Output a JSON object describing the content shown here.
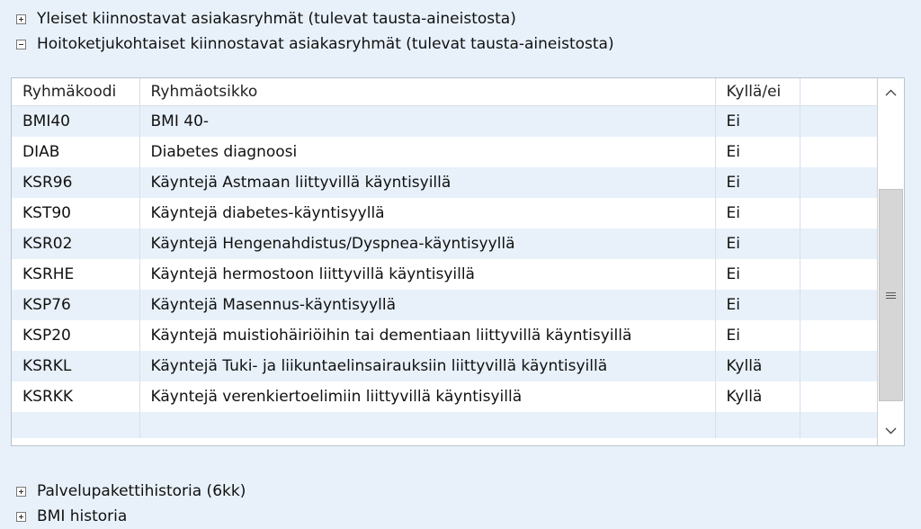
{
  "sections": {
    "general_groups": "Yleiset kiinnostavat asiakasryhmät (tulevat tausta-aineistosta)",
    "care_chain_groups": "Hoitoketjukohtaiset kiinnostavat asiakasryhmät (tulevat tausta-aineistosta)",
    "service_history": "Palvelupakettihistoria (6kk)",
    "bmi_history": "BMI historia"
  },
  "table": {
    "columns": [
      "Ryhmäkoodi",
      "Ryhmäotsikko",
      "Kyllä/ei"
    ],
    "rows": [
      {
        "code": "BMI40",
        "title": "BMI 40-",
        "value": "Ei"
      },
      {
        "code": "DIAB",
        "title": "Diabetes diagnoosi",
        "value": "Ei"
      },
      {
        "code": "KSR96",
        "title": "Käyntejä Astmaan liittyvillä käyntisyillä",
        "value": "Ei"
      },
      {
        "code": "KST90",
        "title": "Käyntejä diabetes-käyntisyyllä",
        "value": "Ei"
      },
      {
        "code": "KSR02",
        "title": "Käyntejä Hengenahdistus/Dyspnea-käyntisyyllä",
        "value": "Ei"
      },
      {
        "code": "KSRHE",
        "title": "Käyntejä hermostoon liittyvillä käyntisyillä",
        "value": "Ei"
      },
      {
        "code": "KSP76",
        "title": "Käyntejä Masennus-käyntisyyllä",
        "value": "Ei"
      },
      {
        "code": "KSP20",
        "title": "Käyntejä muistiohäiriöihin tai dementiaan liittyvillä käyntisyillä",
        "value": "Ei"
      },
      {
        "code": "KSRKL",
        "title": "Käyntejä Tuki- ja liikuntaelinsairauksiin liittyvillä käyntisyillä",
        "value": "Kyllä"
      },
      {
        "code": "KSRKK",
        "title": "Käyntejä verenkiertoelimiin liittyvillä käyntisyillä",
        "value": "Kyllä"
      }
    ]
  },
  "scrollbar": {
    "up_icon": "chevron-up-icon",
    "down_icon": "chevron-down-icon",
    "grip_icon": "grip-icon"
  }
}
